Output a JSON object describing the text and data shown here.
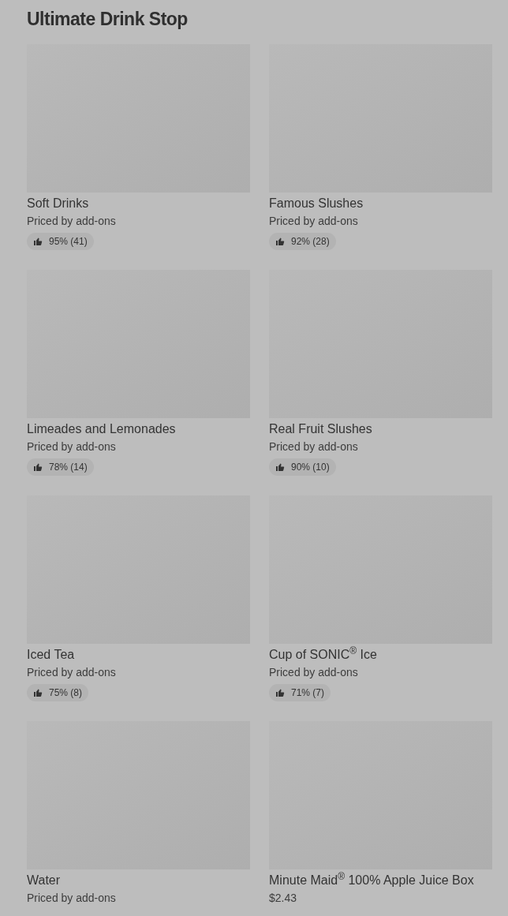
{
  "section": {
    "title": "Ultimate Drink Stop"
  },
  "items": [
    {
      "name": "Soft Drinks",
      "subtitle": "Priced by add-ons",
      "rating": "95% (41)"
    },
    {
      "name": "Famous Slushes",
      "subtitle": "Priced by add-ons",
      "rating": "92% (28)"
    },
    {
      "name": "Limeades and Lemonades",
      "subtitle": "Priced by add-ons",
      "rating": "78% (14)"
    },
    {
      "name": "Real Fruit Slushes",
      "subtitle": "Priced by add-ons",
      "rating": "90% (10)"
    },
    {
      "name": "Iced Tea",
      "subtitle": "Priced by add-ons",
      "rating": "75% (8)"
    },
    {
      "name": "Cup of SONIC$^{®}$ Ice",
      "subtitle": "Priced by add-ons",
      "rating": "71% (7)"
    },
    {
      "name": "Water",
      "subtitle": "Priced by add-ons"
    },
    {
      "name": "Minute Maid$^{®}$ 100% Apple Juice Box",
      "subtitle": "$2.43"
    }
  ]
}
